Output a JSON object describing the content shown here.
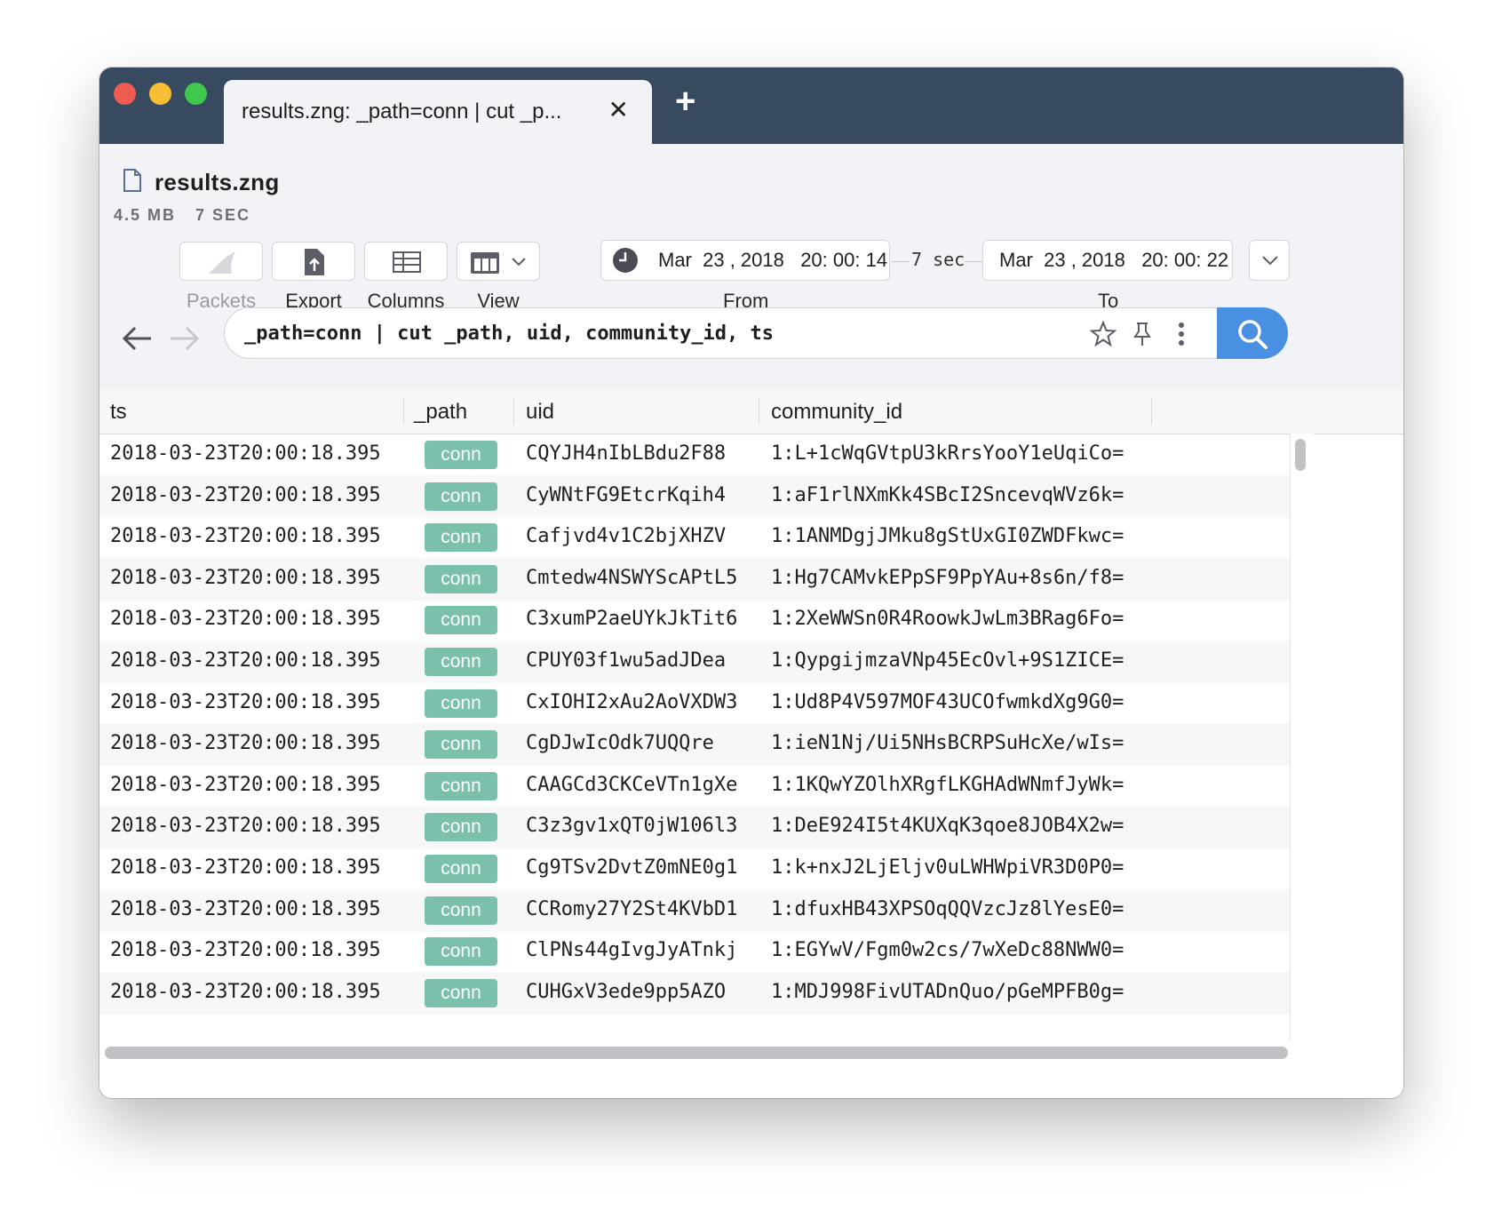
{
  "tab": {
    "title": "results.zng: _path=conn | cut _p...",
    "close_glyph": "✕",
    "new_tab_glyph": "+"
  },
  "file": {
    "name": "results.zng",
    "size": "4.5 MB",
    "duration": "7 SEC"
  },
  "toolbar": {
    "packets_label": "Packets",
    "export_label": "Export",
    "columns_label": "Columns",
    "view_label": "View"
  },
  "time_range": {
    "from_value": "Mar  23 , 2018   20: 00: 14",
    "to_value": "Mar  23 , 2018   20: 00: 22",
    "duration": "7  sec",
    "from_label": "From",
    "to_label": "To"
  },
  "search": {
    "query": "_path=conn | cut _path, uid, community_id, ts"
  },
  "table": {
    "columns": [
      "ts",
      "_path",
      "uid",
      "community_id"
    ],
    "rows": [
      {
        "ts": "2018-03-23T20:00:18.395",
        "path": "conn",
        "uid": "CQYJH4nIbLBdu2F88",
        "community_id": "1:L+1cWqGVtpU3kRrsYooY1eUqiCo="
      },
      {
        "ts": "2018-03-23T20:00:18.395",
        "path": "conn",
        "uid": "CyWNtFG9EtcrKqih4",
        "community_id": "1:aF1rlNXmKk4SBcI2SncevqWVz6k="
      },
      {
        "ts": "2018-03-23T20:00:18.395",
        "path": "conn",
        "uid": "Cafjvd4v1C2bjXHZV",
        "community_id": "1:1ANMDgjJMku8gStUxGI0ZWDFkwc="
      },
      {
        "ts": "2018-03-23T20:00:18.395",
        "path": "conn",
        "uid": "Cmtedw4NSWYScAPtL5",
        "community_id": "1:Hg7CAMvkEPpSF9PpYAu+8s6n/f8="
      },
      {
        "ts": "2018-03-23T20:00:18.395",
        "path": "conn",
        "uid": "C3xumP2aeUYkJkTit6",
        "community_id": "1:2XeWWSn0R4RoowkJwLm3BRag6Fo="
      },
      {
        "ts": "2018-03-23T20:00:18.395",
        "path": "conn",
        "uid": "CPUY03f1wu5adJDea",
        "community_id": "1:QypgijmzaVNp45EcOvl+9S1ZICE="
      },
      {
        "ts": "2018-03-23T20:00:18.395",
        "path": "conn",
        "uid": "CxIOHI2xAu2AoVXDW3",
        "community_id": "1:Ud8P4V597MOF43UCOfwmkdXg9G0="
      },
      {
        "ts": "2018-03-23T20:00:18.395",
        "path": "conn",
        "uid": "CgDJwIcOdk7UQQre",
        "community_id": "1:ieN1Nj/Ui5NHsBCRPSuHcXe/wIs="
      },
      {
        "ts": "2018-03-23T20:00:18.395",
        "path": "conn",
        "uid": "CAAGCd3CKCeVTn1gXe",
        "community_id": "1:1KQwYZOlhXRgfLKGHAdWNmfJyWk="
      },
      {
        "ts": "2018-03-23T20:00:18.395",
        "path": "conn",
        "uid": "C3z3gv1xQT0jW106l3",
        "community_id": "1:DeE924I5t4KUXqK3qoe8JOB4X2w="
      },
      {
        "ts": "2018-03-23T20:00:18.395",
        "path": "conn",
        "uid": "Cg9TSv2DvtZ0mNE0g1",
        "community_id": "1:k+nxJ2LjEljv0uLWHWpiVR3D0P0="
      },
      {
        "ts": "2018-03-23T20:00:18.395",
        "path": "conn",
        "uid": "CCRomy27Y2St4KVbD1",
        "community_id": "1:dfuxHB43XPSOqQQVzcJz8lYesE0="
      },
      {
        "ts": "2018-03-23T20:00:18.395",
        "path": "conn",
        "uid": "ClPNs44gIvgJyATnkj",
        "community_id": "1:EGYwV/Fgm0w2cs/7wXeDc88NWW0="
      },
      {
        "ts": "2018-03-23T20:00:18.395",
        "path": "conn",
        "uid": "CUHGxV3ede9pp5AZO",
        "community_id": "1:MDJ998FivUTADnQuo/pGeMPFB0g="
      }
    ]
  },
  "colors": {
    "titlebar": "#384a60",
    "badge": "#7bc0ad",
    "search_button": "#4a90e2"
  },
  "icons": {
    "file": "file-icon",
    "packets": "shark-fin-icon",
    "export": "export-icon",
    "columns": "columns-icon",
    "view": "view-icon",
    "clock": "clock-icon",
    "back": "back-arrow-icon",
    "forward": "forward-arrow-icon",
    "star": "star-icon",
    "pin": "pin-icon",
    "more": "more-vertical-icon",
    "search": "search-icon"
  }
}
